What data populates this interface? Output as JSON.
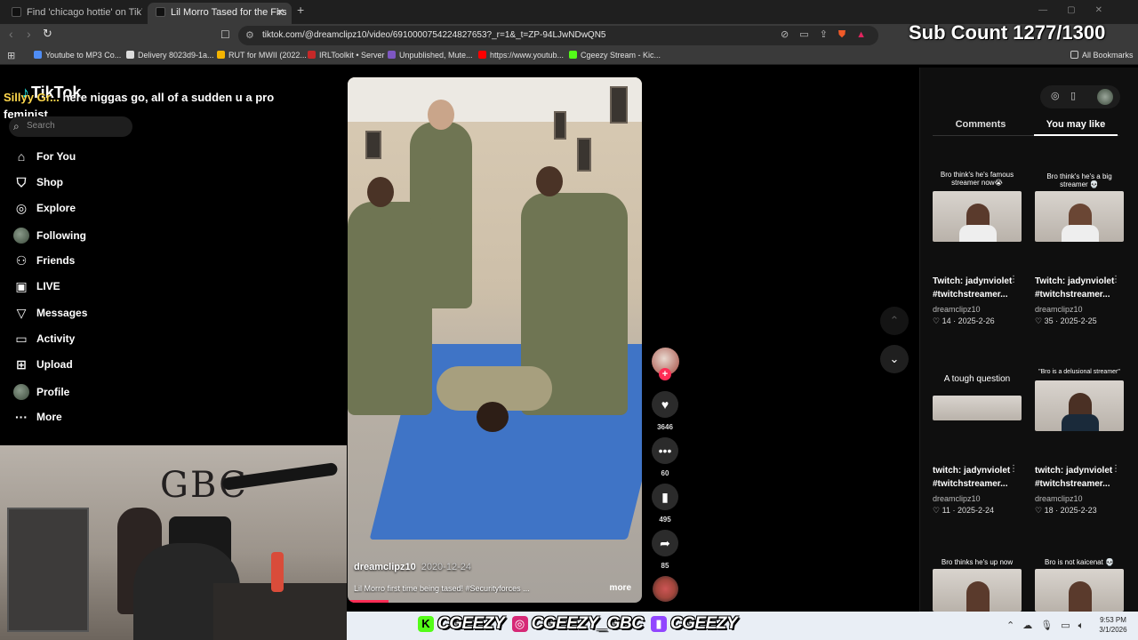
{
  "browser": {
    "tabs": [
      {
        "title": "Find 'chicago hottie' on TikTok | TikTo",
        "active": false
      },
      {
        "title": "Lil Morro Tased for the First Time",
        "active": true
      }
    ],
    "url": "tiktok.com/@dreamclipz10/video/6910000754224827653?_r=1&_t=ZP-94LJwNDwQN5",
    "bookmarks": [
      "Youtube to MP3 Co...",
      "Delivery 8023d9-1a...",
      "RUT for MWII (2022...",
      "IRLToolkit • Server",
      "Unpublished, Mute...",
      "https://www.youtub...",
      "Cgeezy Stream - Kic..."
    ],
    "all_bookmarks": "All Bookmarks"
  },
  "overlay": {
    "sub_count": "Sub Count 1277/1300",
    "chat_user": "Sillyy Gr...",
    "chat_message": " here niggas go, all of a sudden u a pro feminist"
  },
  "tiktok": {
    "logo": "TikTok",
    "search_placeholder": "Search",
    "nav": [
      {
        "label": "For You",
        "icon": "home-icon"
      },
      {
        "label": "Shop",
        "icon": "shop-bag-icon"
      },
      {
        "label": "Explore",
        "icon": "compass-icon"
      },
      {
        "label": "Following",
        "icon": "following-avatar-icon"
      },
      {
        "label": "Friends",
        "icon": "friends-icon"
      },
      {
        "label": "LIVE",
        "icon": "live-tv-icon"
      },
      {
        "label": "Messages",
        "icon": "send-icon"
      },
      {
        "label": "Activity",
        "icon": "message-square-icon"
      },
      {
        "label": "Upload",
        "icon": "plus-square-icon"
      },
      {
        "label": "Profile",
        "icon": "profile-avatar-icon"
      },
      {
        "label": "More",
        "icon": "ellipsis-icon"
      }
    ]
  },
  "video": {
    "author": "dreamclipz10",
    "date": "2020-12-24",
    "caption": "Lil Morro first time being tased! #Securityforces ...",
    "more": "more",
    "likes": "3646",
    "comments": "60",
    "saves": "495",
    "shares": "85",
    "progress": 0.14
  },
  "right_panel": {
    "tabs": [
      "Comments",
      "You may like"
    ],
    "active_tab": "You may like",
    "cards": [
      {
        "caption": "Bro think's he's famous streamer now😭",
        "title1": "Twitch: jadynviolet",
        "title2": "#twitchstreamer...",
        "author": "dreamclipz10",
        "likes": "14",
        "date": "2025-2-26"
      },
      {
        "caption": "Bro think's he's a big streamer 💀",
        "title1": "Twitch: jadynviolet",
        "title2": "#twitchstreamer...",
        "author": "dreamclipz10",
        "likes": "35",
        "date": "2025-2-25"
      },
      {
        "caption": "A tough question",
        "title1": "twitch: jadynviolet",
        "title2": "#twitchstreamer...",
        "author": "dreamclipz10",
        "likes": "11",
        "date": "2025-2-24"
      },
      {
        "caption": "\"Bro is a delusional streamer\"",
        "title1": "twitch: jadynviolet",
        "title2": "#twitchstreamer...",
        "author": "dreamclipz10",
        "likes": "18",
        "date": "2025-2-23"
      },
      {
        "caption": "Bro thinks he's up now",
        "title1": "",
        "title2": "",
        "author": "",
        "likes": "",
        "date": ""
      },
      {
        "caption": "Bro is not kaicenat 💀",
        "title1": "",
        "title2": "",
        "author": "",
        "likes": "",
        "date": ""
      }
    ]
  },
  "webcam": {
    "wall_text": "GBC"
  },
  "socials": [
    {
      "platform": "kick",
      "icon_letter": "K",
      "color": "#53fc18",
      "handle": "CGEEZY"
    },
    {
      "platform": "instagram",
      "icon_letter": "◎",
      "color": "#d62976",
      "handle": "CGEEZY_GBC"
    },
    {
      "platform": "twitch",
      "icon_letter": "▮",
      "color": "#9146ff",
      "handle": "CGEEZY"
    }
  ],
  "taskbar": {
    "time": "9:53 PM",
    "date": "3/1/2026"
  }
}
